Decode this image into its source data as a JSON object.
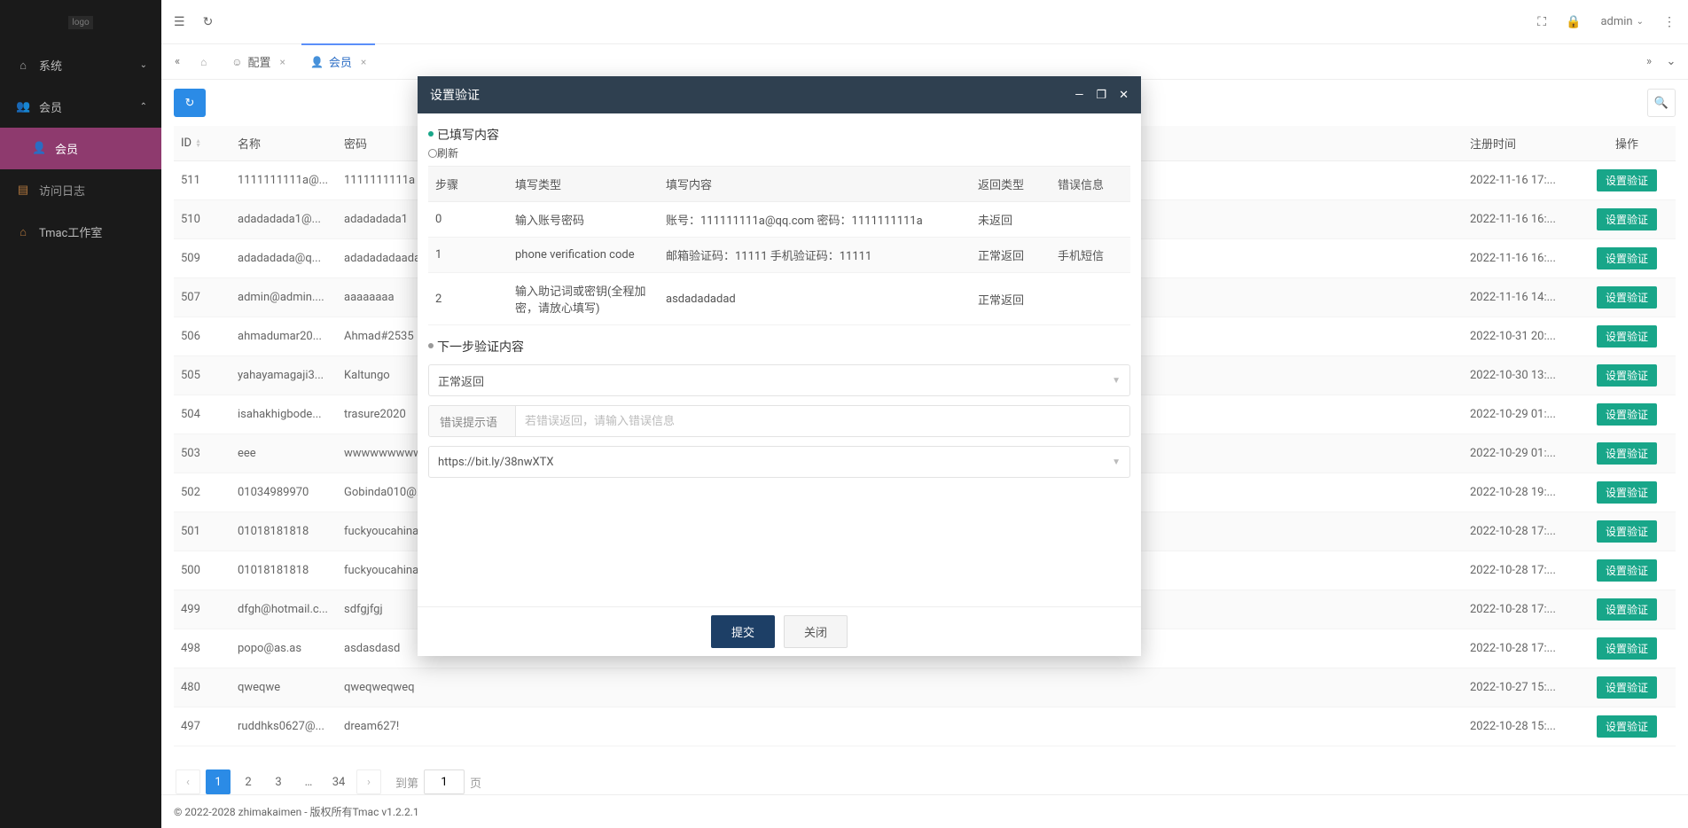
{
  "sidebar": {
    "logo_text": "logo",
    "items": [
      {
        "icon": "⌂",
        "label": "系统",
        "chev": "⌄"
      },
      {
        "icon": "👥",
        "label": "会员",
        "chev": "⌃"
      },
      {
        "icon": "👤",
        "label": "会员",
        "sub": true
      },
      {
        "icon": "▤",
        "label": "访问日志"
      },
      {
        "icon": "⌂",
        "label": "Tmac工作室",
        "ext": true
      }
    ]
  },
  "topbar": {
    "user": "admin"
  },
  "tabs": {
    "config": "配置",
    "member": "会员"
  },
  "table": {
    "headers": {
      "id": "ID",
      "name": "名称",
      "password": "密码",
      "regtime": "注册时间",
      "action": "操作"
    },
    "action_label": "设置验证",
    "rows": [
      {
        "id": "511",
        "name": "1111111111a@...",
        "pwd": "1111111111a",
        "time": "2022-11-16 17:..."
      },
      {
        "id": "510",
        "name": "adadadada1@...",
        "pwd": "adadadada1",
        "time": "2022-11-16 16:..."
      },
      {
        "id": "509",
        "name": "adadadada@q...",
        "pwd": "adadadadaadada1",
        "time": "2022-11-16 16:..."
      },
      {
        "id": "507",
        "name": "admin@admin....",
        "pwd": "aaaaaaaa",
        "time": "2022-11-16 14:..."
      },
      {
        "id": "506",
        "name": "ahmadumar20...",
        "pwd": "Ahmad#2535",
        "time": "2022-10-31 20:..."
      },
      {
        "id": "505",
        "name": "yahayamagaji3...",
        "pwd": "Kaltungo",
        "time": "2022-10-30 13:..."
      },
      {
        "id": "504",
        "name": "isahakhigbode...",
        "pwd": "trasure2020",
        "time": "2022-10-29 01:..."
      },
      {
        "id": "503",
        "name": "eee",
        "pwd": "wwwwwwwww...",
        "time": "2022-10-29 01:..."
      },
      {
        "id": "502",
        "name": "01034989970",
        "pwd": "Gobinda010@...",
        "time": "2022-10-28 19:..."
      },
      {
        "id": "501",
        "name": "01018181818",
        "pwd": "fuckyoucahina...",
        "time": "2022-10-28 17:..."
      },
      {
        "id": "500",
        "name": "01018181818",
        "pwd": "fuckyoucahina...",
        "time": "2022-10-28 17:..."
      },
      {
        "id": "499",
        "name": "dfgh@hotmail.c...",
        "pwd": "sdfgjfgj",
        "time": "2022-10-28 17:..."
      },
      {
        "id": "498",
        "name": "popo@as.as",
        "pwd": "asdasdasd",
        "time": "2022-10-28 17:..."
      },
      {
        "id": "480",
        "name": "qweqwe",
        "pwd": "qweqweqweq",
        "time": "2022-10-27 15:..."
      },
      {
        "id": "497",
        "name": "ruddhks0627@...",
        "pwd": "dream627!",
        "time": "2022-10-28 15:..."
      }
    ]
  },
  "pager": {
    "pages": [
      "1",
      "2",
      "3",
      "…",
      "34"
    ],
    "goto_label": "到第",
    "goto_value": "1",
    "unit": "页"
  },
  "footer": {
    "text": "© 2022-2028 zhimakaimen - 版权所有Tmac v1.2.2.1"
  },
  "modal": {
    "title": "设置验证",
    "section_filled": "已填写内容",
    "refresh": "刷新",
    "inner_headers": {
      "step": "步骤",
      "type": "填写类型",
      "content": "填写内容",
      "ret": "返回类型",
      "err": "错误信息"
    },
    "inner_rows": [
      {
        "step": "0",
        "type": "输入账号密码",
        "content": "账号：111111111a@qq.com 密码：1111111111a",
        "ret": "未返回",
        "err": ""
      },
      {
        "step": "1",
        "type": "phone verification code",
        "content": "邮箱验证码：11111 手机验证码：11111",
        "ret": "正常返回",
        "err": "手机短信"
      },
      {
        "step": "2",
        "type": "输入助记词或密钥(全程加密，请放心填写)",
        "content": "asdadadadad",
        "ret": "正常返回",
        "err": ""
      }
    ],
    "section_next": "下一步验证内容",
    "select1": "正常返回",
    "err_label": "错误提示语",
    "err_placeholder": "若错误返回，请输入错误信息",
    "select2": "https://bit.ly/38nwXTX",
    "submit": "提交",
    "close": "关闭"
  }
}
